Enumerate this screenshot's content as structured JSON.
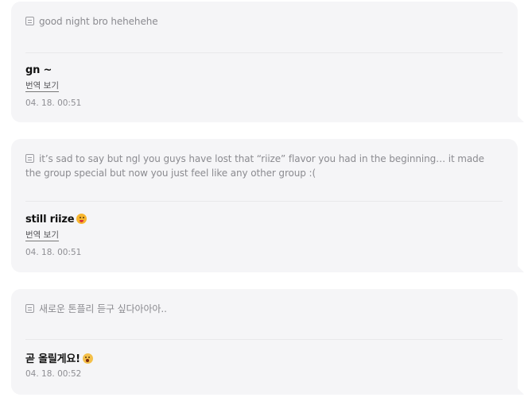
{
  "messages": [
    {
      "quote": "good night bro hehehehe",
      "reply": "gn ~",
      "reply_emoji": "",
      "translate_label": "번역 보기",
      "time": "04. 18. 00:51"
    },
    {
      "quote": "it’s sad to say but ngl you guys have lost that “riize” flavor you had in the beginning… it made the group special but now you just feel like any other group :(",
      "reply": "still riize",
      "reply_emoji": "squinting-face-with-tongue",
      "translate_label": "번역 보기",
      "time": "04. 18. 00:51"
    },
    {
      "quote": "새로운 톤플리 듣구 싶다아아아..",
      "reply": "곧 올릴게요!",
      "reply_emoji": "astonished-face",
      "time": "04. 18. 00:52"
    }
  ],
  "colors": {
    "card_background": "#f5f5f7",
    "quote_text": "#8b8b90",
    "reply_text": "#111111",
    "timestamp_text": "#8e8e93"
  },
  "icons": {
    "quote": "quote-message-icon"
  }
}
